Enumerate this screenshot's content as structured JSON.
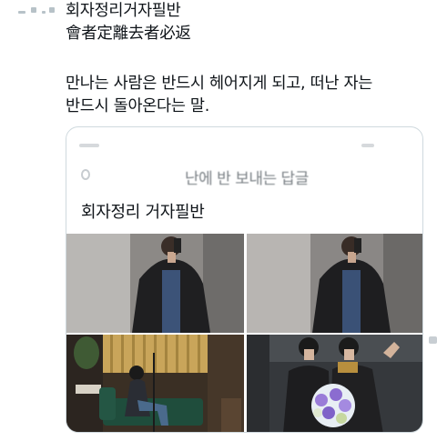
{
  "tweet": {
    "lines": [
      "회자정리거자필반",
      "會者定離去者必返",
      "만나는 사람은 반드시 헤어지게 되고, 떠난 자는",
      "반드시 돌아온다는 말."
    ]
  },
  "card": {
    "subtitle": "난에 반 보내는 답글",
    "title": "회자정리 거자필반",
    "photos": [
      {
        "label": "mirror-selfie-photo-1"
      },
      {
        "label": "mirror-selfie-photo-2"
      },
      {
        "label": "studio-sofa-photo"
      },
      {
        "label": "flower-bouquet-photo"
      }
    ]
  },
  "colors": {
    "text": "#0f1419",
    "border": "#cfd9de",
    "muted": "#7b8186"
  }
}
